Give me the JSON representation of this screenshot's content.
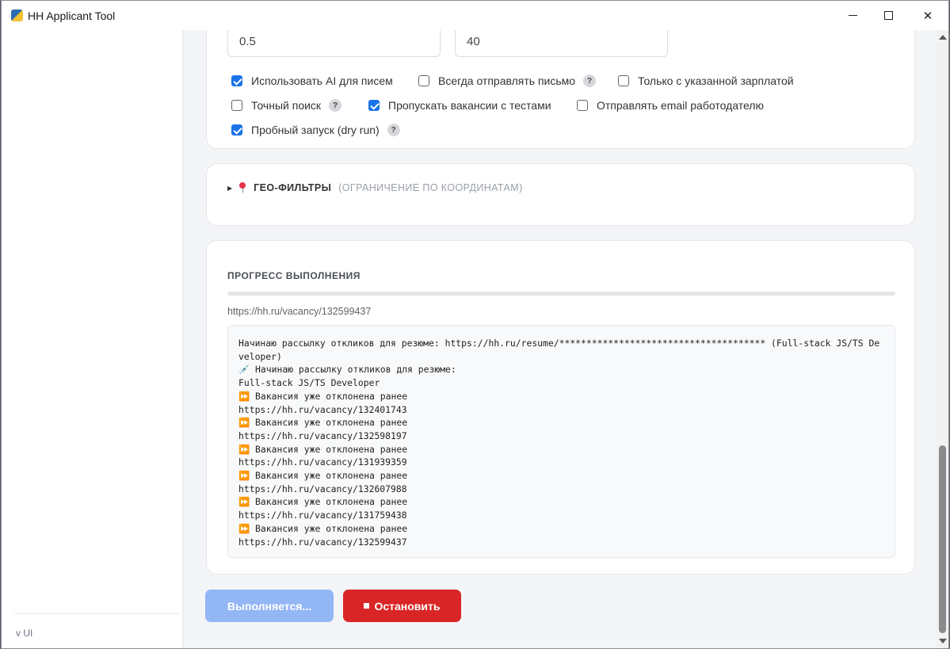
{
  "window": {
    "title": "HH Applicant Tool"
  },
  "sidebar": {
    "version": "v UI"
  },
  "settings": {
    "input_1_value": "0.5",
    "input_2_value": "40",
    "options": [
      {
        "label": "Использовать AI для писем",
        "checked": true,
        "help": false
      },
      {
        "label": "Всегда отправлять письмо",
        "checked": false,
        "help": true
      },
      {
        "label": "Только с указанной зарплатой",
        "checked": false,
        "help": false
      },
      {
        "label": "Точный поиск",
        "checked": false,
        "help": true
      },
      {
        "label": "Пропускать вакансии с тестами",
        "checked": true,
        "help": false
      },
      {
        "label": "Отправлять email работодателю",
        "checked": false,
        "help": false
      },
      {
        "label": "Пробный запуск (dry run)",
        "checked": true,
        "help": true
      }
    ],
    "help_glyph": "?"
  },
  "geo": {
    "title": "ГЕО-ФИЛЬТРЫ",
    "subtitle": "(ОГРАНИЧЕНИЕ ПО КООРДИНАТАМ)",
    "icon": "pin-icon"
  },
  "progress": {
    "title": "ПРОГРЕСС ВЫПОЛНЕНИЯ",
    "value": 0,
    "current_url": "https://hh.ru/vacancy/132599437",
    "log": "Начинаю рассылку откликов для резюме: https://hh.ru/resume/************************************** (Full-stack JS/TS Developer)\n💉 Начинаю рассылку откликов для резюме:\nFull-stack JS/TS Developer\n⏩ Вакансия уже отклонена ранее\nhttps://hh.ru/vacancy/132401743\n⏩ Вакансия уже отклонена ранее\nhttps://hh.ru/vacancy/132598197\n⏩ Вакансия уже отклонена ранее\nhttps://hh.ru/vacancy/131939359\n⏩ Вакансия уже отклонена ранее\nhttps://hh.ru/vacancy/132607988\n⏩ Вакансия уже отклонена ранее\nhttps://hh.ru/vacancy/131759438\n⏩ Вакансия уже отклонена ранее\nhttps://hh.ru/vacancy/132599437"
  },
  "actions": {
    "running_label": "Выполняется...",
    "stop_label": "Остановить"
  },
  "colors": {
    "accent": "#1a73e8",
    "running_button": "#93b6f5",
    "stop_button": "#d92525"
  }
}
